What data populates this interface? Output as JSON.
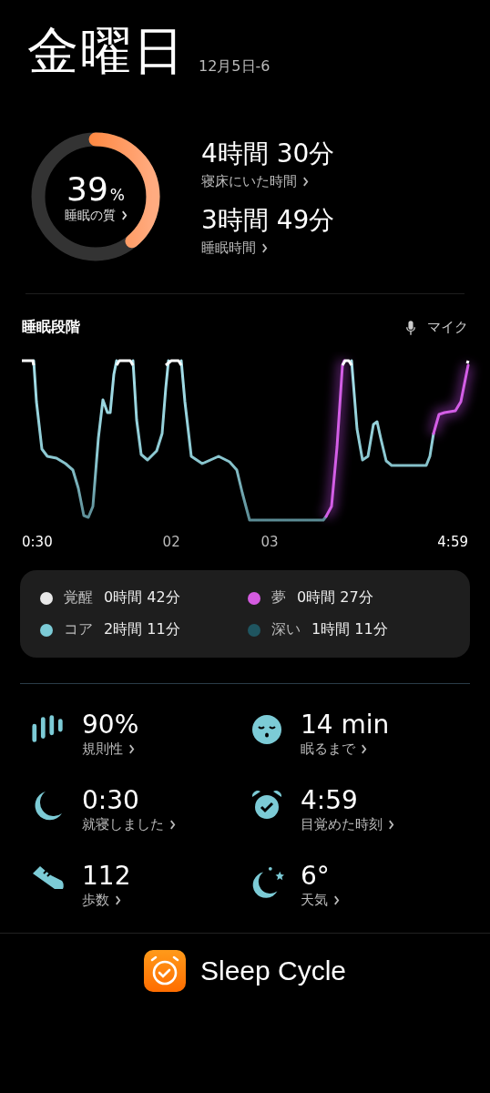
{
  "header": {
    "day": "金曜日",
    "date": "12月5日-6"
  },
  "quality": {
    "value": "39",
    "unit": "%",
    "label": "睡眠の質",
    "level": 0.39
  },
  "durations": [
    {
      "value": "4時間 30分",
      "label": "寝床にいた時間"
    },
    {
      "value": "3時間 49分",
      "label": "睡眠時間"
    }
  ],
  "stages": {
    "title": "睡眠段階",
    "mic": "マイク",
    "time_labels": [
      "0:30",
      "02",
      "03",
      "4:59"
    ]
  },
  "legend": [
    {
      "name": "覚醒",
      "duration": "0時間 42分",
      "color": "#e8e8e8"
    },
    {
      "name": "夢",
      "duration": "0時間 27分",
      "color": "#d45be0"
    },
    {
      "name": "コア",
      "duration": "2時間 11分",
      "color": "#7ccbd6"
    },
    {
      "name": "深い",
      "duration": "1時間 11分",
      "color": "#1f5560"
    }
  ],
  "stats": [
    {
      "kind": "regularity",
      "value": "90%",
      "label": "規則性"
    },
    {
      "kind": "fall_asleep",
      "value": "14 min",
      "label": "眠るまで"
    },
    {
      "kind": "bedtime",
      "value": "0:30",
      "label": "就寝しました"
    },
    {
      "kind": "wakeup",
      "value": "4:59",
      "label": "目覚めた時刻"
    },
    {
      "kind": "steps",
      "value": "112",
      "label": "歩数"
    },
    {
      "kind": "weather",
      "value": "6°",
      "label": "天気"
    }
  ],
  "footer": {
    "brand": "Sleep Cycle"
  }
}
